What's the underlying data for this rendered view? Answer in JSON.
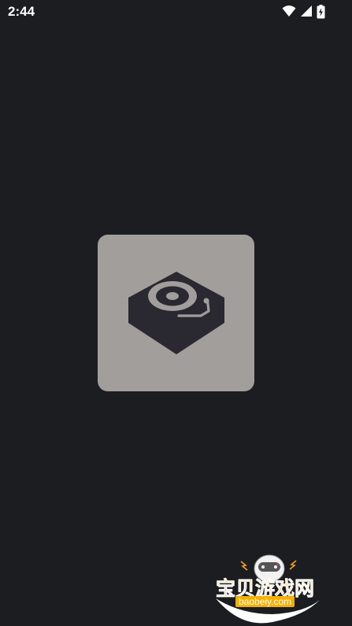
{
  "status_bar": {
    "time": "2:44",
    "icons": [
      "wifi-icon",
      "cellular-signal-icon",
      "battery-charging-icon"
    ]
  },
  "splash": {
    "icon": "turntable-icon"
  },
  "watermark": {
    "title": "宝贝游戏网",
    "url": "baobeiy.com"
  },
  "colors": {
    "background": "#1b1d20",
    "tile": "#a19e9b",
    "icon_dark": "#2a2830",
    "watermark_orange": "#f5a019"
  }
}
